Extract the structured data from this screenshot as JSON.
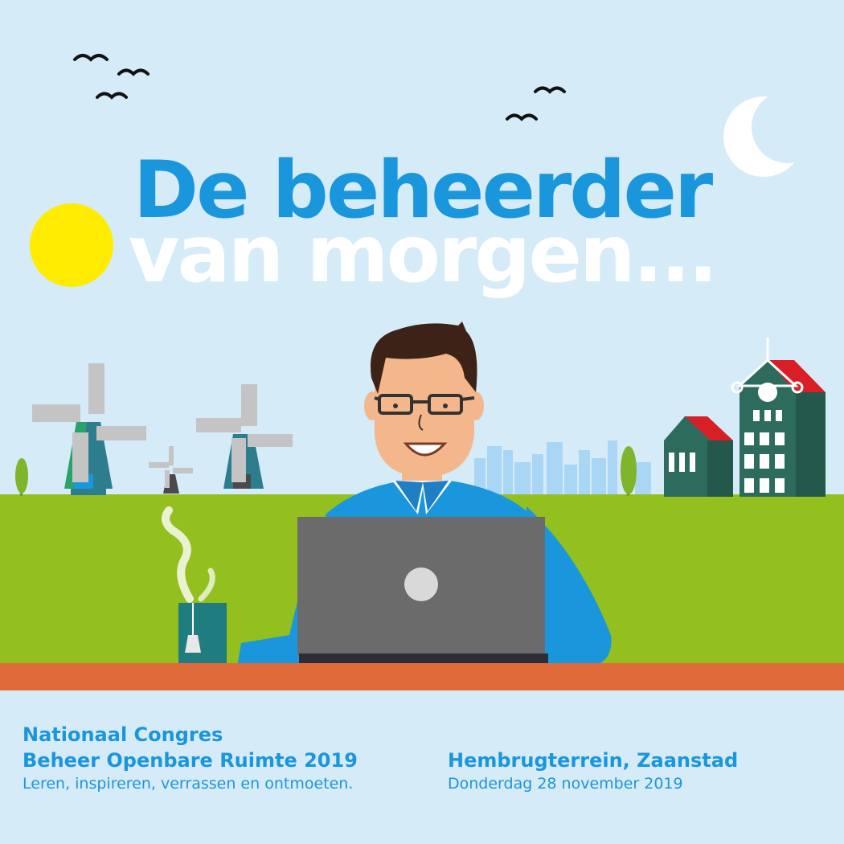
{
  "headline": {
    "line1": "De beheerder",
    "line2": "van morgen..."
  },
  "event": {
    "title_line1": "Nationaal Congres",
    "title_line2": "Beheer Openbare Ruimte 2019",
    "tagline": "Leren, inspireren, verrassen en ontmoeten.",
    "location": "Hembrugterrein, Zaanstad",
    "date": "Donderdag 28 november 2019"
  },
  "colors": {
    "sky": "#d5ebf8",
    "grass": "#93c01f",
    "accent_blue": "#1a96dd",
    "sun": "#ffec00",
    "table": "#e06a3a",
    "laptop": "#6b6b6b",
    "house": "#2d6b5c",
    "roof": "#d91f26"
  }
}
